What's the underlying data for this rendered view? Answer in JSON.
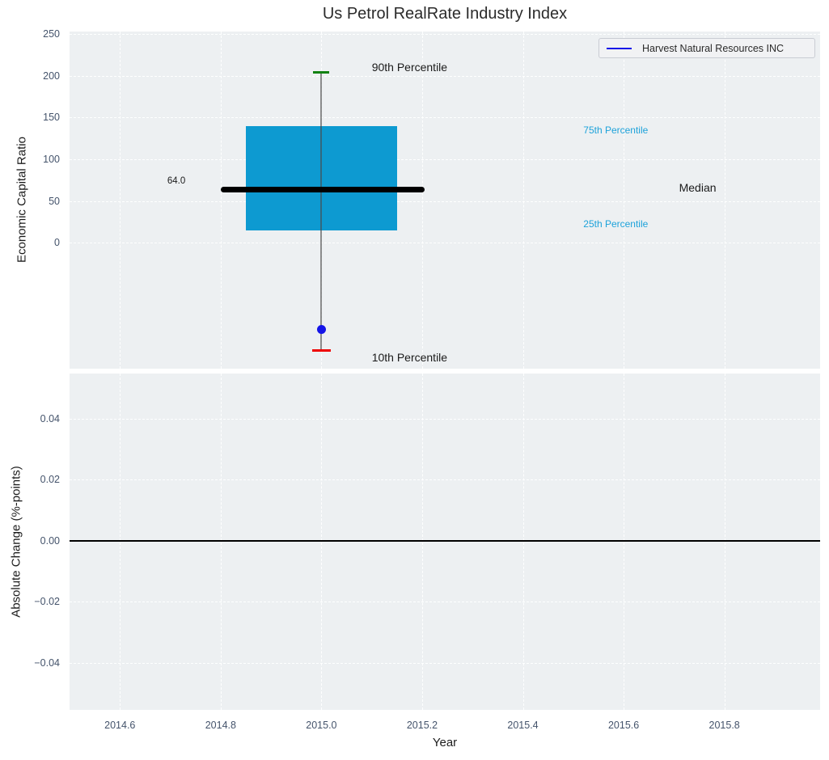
{
  "title": "Us Petrol RealRate Industry Index",
  "legend": {
    "label": "Harvest Natural Resources INC",
    "line_color": "#1414e8"
  },
  "colors": {
    "axes_background": "#edf0f2",
    "grid": "#ffffff",
    "tick_label": "#44536b",
    "box_fill": "#0d9ad1",
    "median_line": "#000000",
    "whisker": "#4a4a4a",
    "p90_cap": "#128212",
    "p10_cap": "#ee0000",
    "company_point": "#1414e8",
    "percentile_text_blue": "#1da2da",
    "annotation_text_dark": "#1a1a1a",
    "zero_line": "#000000"
  },
  "chart_data": [
    {
      "type": "boxplot",
      "title": "Us Petrol RealRate Industry Index",
      "xlabel": "Year",
      "ylabel": "Economic Capital Ratio",
      "xlim": [
        2014.5,
        2015.99
      ],
      "ylim": [
        -151,
        253
      ],
      "grid": "white-dashed",
      "xticks": [
        2014.6,
        2014.8,
        2015.0,
        2015.2,
        2015.4,
        2015.6,
        2015.8
      ],
      "xtick_labels": [
        "2014.6",
        "2014.8",
        "2015.0",
        "2015.2",
        "2015.4",
        "2015.6",
        "2015.8"
      ],
      "yticks": [
        250,
        200,
        150,
        100,
        50,
        0
      ],
      "ytick_labels": [
        "250",
        "200",
        "150",
        "100",
        "50",
        "0"
      ],
      "box": {
        "x_center": 2015.0,
        "box_left": 2014.85,
        "box_right": 2015.15,
        "median_left": 2014.8,
        "median_right": 2015.205,
        "p90": 204,
        "p75": 140,
        "median": 64,
        "p25": 15,
        "p10": -129,
        "median_label": "64.0",
        "p90_cap_halfwidth": 0.016,
        "p10_cap_halfwidth": 0.018
      },
      "company_point": {
        "name": "Harvest Natural Resources INC",
        "x": 2015.0,
        "y": -104
      },
      "annotations": [
        {
          "text": "90th Percentile",
          "x": 2015.1,
          "y": 210,
          "anchor": "left",
          "color": "#1a1a1a",
          "size": 14
        },
        {
          "text": "10th Percentile",
          "x": 2015.1,
          "y": -137,
          "anchor": "left",
          "color": "#1a1a1a",
          "size": 14
        },
        {
          "text": "75th Percentile",
          "x": 2015.52,
          "y": 135,
          "anchor": "left",
          "color": "#1da2da",
          "size": 12
        },
        {
          "text": "25th Percentile",
          "x": 2015.52,
          "y": 22,
          "anchor": "left",
          "color": "#1da2da",
          "size": 12
        },
        {
          "text": "Median",
          "x": 2015.71,
          "y": 66,
          "anchor": "left",
          "color": "#1a1a1a",
          "size": 14
        },
        {
          "text": "64.0",
          "x": 2014.73,
          "y": 74,
          "anchor": "right",
          "color": "#1a1a1a",
          "size": 11.5
        }
      ],
      "legend_position": "upper right"
    },
    {
      "type": "line",
      "xlabel": "Year",
      "ylabel": "Absolute Change (%-points)",
      "xlim": [
        2014.5,
        2015.99
      ],
      "ylim": [
        -0.0554,
        0.0548
      ],
      "grid": "white-dashed",
      "yticks": [
        0.04,
        0.02,
        0.0,
        -0.02,
        -0.04
      ],
      "ytick_labels": [
        "0.04",
        "0.02",
        "0.00",
        "−0.02",
        "−0.04"
      ],
      "zero_line_y": 0.0,
      "series": []
    }
  ]
}
